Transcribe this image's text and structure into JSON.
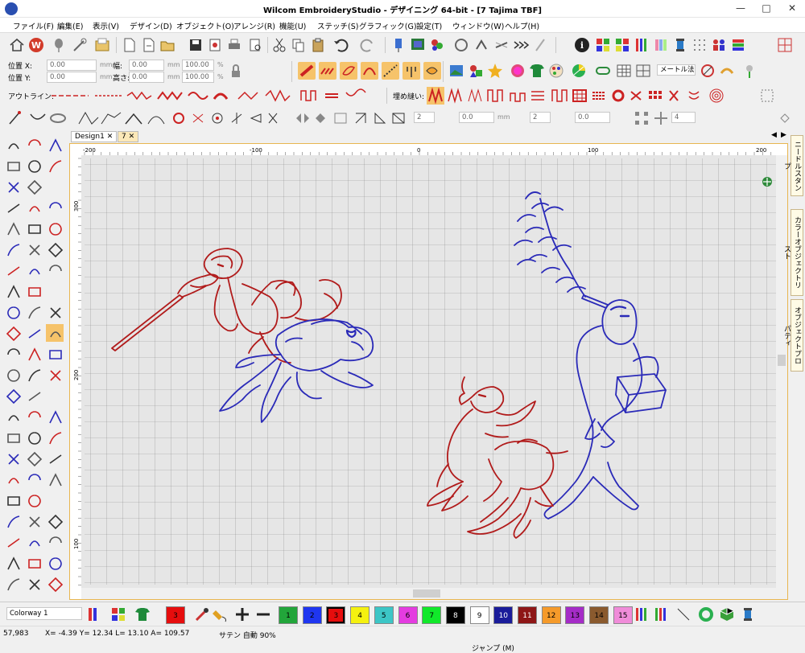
{
  "window": {
    "title": "Wilcom EmbroideryStudio - デザイニング 64-bit - [7        Tajima TBF]",
    "controls": [
      "—",
      "□",
      "✕"
    ]
  },
  "menu": [
    "ファイル(F)",
    "編集(E)",
    "表示(V)",
    "デザイン(D)",
    "オブジェクト(O)",
    "アレンジ(R)",
    "機能(U)",
    "ステッチ(S)",
    "グラフィック(G)",
    "設定(T)",
    "ウィンドウ(W)",
    "ヘルプ(H)"
  ],
  "position": {
    "x_label": "位置 X:",
    "y_label": "位置 Y:",
    "w_label": "幅:",
    "h_label": "高さ:",
    "x_value": "0.00",
    "y_value": "0.00",
    "w_value": "0.00",
    "h_value": "0.00",
    "w_pct": "100.00",
    "h_pct": "100.00",
    "unit_mm": "mm",
    "unit_pct": "%"
  },
  "units_dropdown": "メートル法",
  "outline_label": "アウトライン:",
  "fill_label": "埋め縫い:",
  "stepper": {
    "count1": "2",
    "val1": "0.0",
    "count2": "2",
    "val2": "0.0",
    "count3": "4",
    "unit": "mm"
  },
  "tabs": [
    {
      "label": "Design1",
      "close": "✕"
    },
    {
      "label": "7",
      "close": "✕"
    }
  ],
  "ruler": {
    "top": [
      {
        "label": "-200"
      },
      {
        "label": "-100"
      },
      {
        "label": "0"
      },
      {
        "label": "100"
      },
      {
        "label": "200"
      }
    ],
    "left": [
      {
        "label": "300"
      },
      {
        "label": "200"
      },
      {
        "label": "100"
      }
    ]
  },
  "right_panels": [
    "ニードルスタンプ",
    "カラーオブジェクトリスト",
    "オブジェクトプロパティ"
  ],
  "colorway": "Colorway 1",
  "current_color": "3",
  "palette": [
    {
      "num": "1",
      "color": "#22a53a"
    },
    {
      "num": "2",
      "color": "#1f36f0"
    },
    {
      "num": "3",
      "color": "#e60d0d"
    },
    {
      "num": "4",
      "color": "#f5f10f"
    },
    {
      "num": "5",
      "color": "#3cc6c6"
    },
    {
      "num": "6",
      "color": "#e43ce0"
    },
    {
      "num": "7",
      "color": "#11e82a"
    },
    {
      "num": "8",
      "color": "#000000"
    },
    {
      "num": "9",
      "color": "#ffffff"
    },
    {
      "num": "10",
      "color": "#1a1c9a"
    },
    {
      "num": "11",
      "color": "#8e1616"
    },
    {
      "num": "12",
      "color": "#f59a2a"
    },
    {
      "num": "13",
      "color": "#a52cc7"
    },
    {
      "num": "14",
      "color": "#8a5a2e"
    },
    {
      "num": "15",
      "color": "#f08cd9"
    }
  ],
  "status": {
    "count": "57,983",
    "coords": "X=  -4.39 Y=  12.34 L=  13.10 A= 109.57",
    "mode": "サテン 自動 90%",
    "jump": "ジャンプ (M)"
  },
  "colors": {
    "red": "#b11b1b",
    "blue": "#2a2ab8",
    "accent": "#e8b650"
  }
}
